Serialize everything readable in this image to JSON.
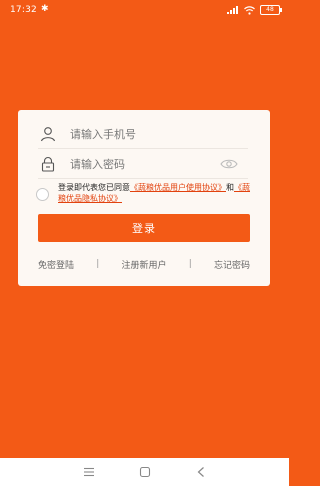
{
  "status_bar": {
    "time": "17:32",
    "battery": "48"
  },
  "login_card": {
    "phone_placeholder": "请输入手机号",
    "password_placeholder": "请输入密码",
    "agreement_prefix": "登录即代表您已同意",
    "user_agreement_link": "《蔬粮优品用户使用协议》",
    "agreement_and": "和",
    "privacy_link": "《蔬粮优品隐私协议》",
    "login_button": "登录",
    "bottom_links": {
      "password_free": "免密登陆",
      "separator": "|",
      "register": "注册新用户",
      "forgot": "忘记密码"
    }
  },
  "colors": {
    "brand": "#F35A16",
    "card": "#FDF8F3",
    "link": "#E2420E"
  },
  "icons": [
    "bluetooth-icon",
    "signal-icon",
    "wifi-icon",
    "battery-icon",
    "user-icon",
    "lock-icon",
    "eye-icon",
    "menu-icon",
    "home-icon",
    "back-icon"
  ]
}
